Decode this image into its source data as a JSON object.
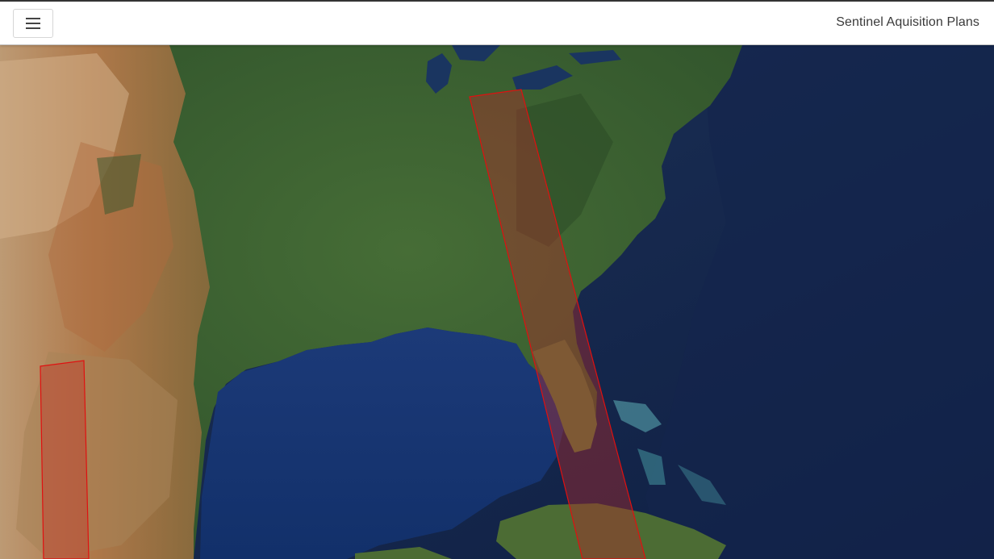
{
  "header": {
    "title": "Sentinel Aquisition Plans",
    "menu_icon": "hamburger-menu-icon"
  },
  "map": {
    "basemap": "satellite imagery",
    "footprints": [
      {
        "id": "east-swath",
        "stroke": "#e01010",
        "fill": "#c0392b"
      },
      {
        "id": "west-swath",
        "stroke": "#e01010",
        "fill": "#c0392b"
      }
    ]
  },
  "colors": {
    "ocean": "#13254a",
    "land_green": "#3d6232",
    "land_desert": "#b98555",
    "footprint_stroke": "#e01010",
    "footprint_fill": "#c0392b"
  }
}
